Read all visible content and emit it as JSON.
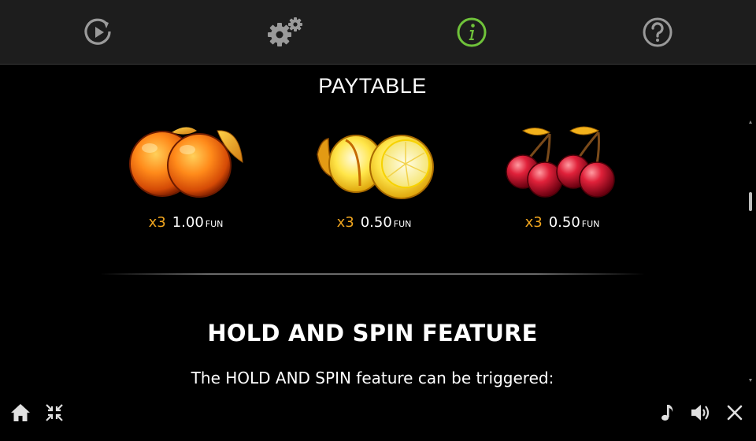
{
  "topbar": {
    "icons": [
      "autoplay-icon",
      "settings-icon",
      "info-icon",
      "help-icon"
    ],
    "active_color": "#6fc23a",
    "inactive_color": "#9a9a9a"
  },
  "paytable": {
    "title": "PAYTABLE",
    "symbols": [
      {
        "name": "orange-symbol",
        "multiplier": "x3",
        "amount": "1.00",
        "currency": "FUN"
      },
      {
        "name": "lemon-symbol",
        "multiplier": "x3",
        "amount": "0.50",
        "currency": "FUN"
      },
      {
        "name": "cherry-symbol",
        "multiplier": "x3",
        "amount": "0.50",
        "currency": "FUN"
      }
    ]
  },
  "feature": {
    "heading": "HOLD AND SPIN FEATURE",
    "text": "The HOLD AND SPIN feature can be triggered:"
  },
  "bottombar": {
    "left_icons": [
      "home-icon",
      "exit-fullscreen-icon"
    ],
    "right_icons": [
      "music-icon",
      "sound-icon",
      "close-icon"
    ]
  },
  "colors": {
    "accent_orange": "#f0a51e",
    "topbar_bg": "#1d1d1d"
  }
}
